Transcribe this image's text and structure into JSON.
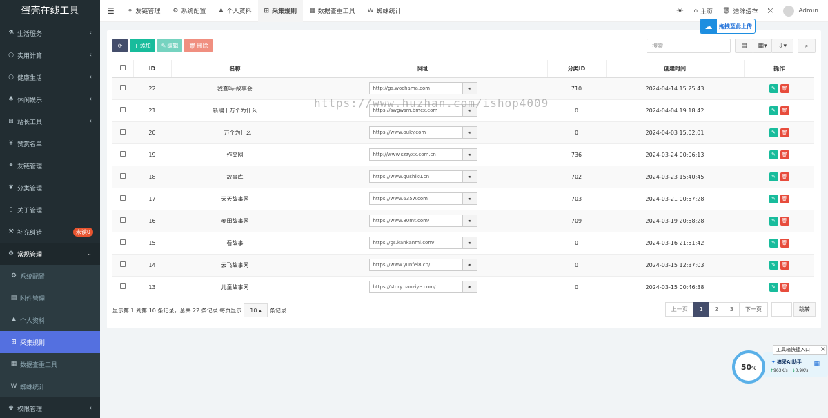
{
  "app": {
    "title": "蛋壳在线工具"
  },
  "sidebar": {
    "items": [
      {
        "label": "生活服务",
        "icon": "flask-icon",
        "glyph": "⚗",
        "arrow": true
      },
      {
        "label": "实用计算",
        "icon": "circle-icon",
        "glyph": "○",
        "arrow": true
      },
      {
        "label": "健康生活",
        "icon": "circle-icon",
        "glyph": "○",
        "arrow": true
      },
      {
        "label": "休闲娱乐",
        "icon": "gamepad-icon",
        "glyph": "♣",
        "arrow": true
      },
      {
        "label": "站长工具",
        "icon": "sitemap-icon",
        "glyph": "⊞",
        "arrow": true
      },
      {
        "label": "赞赏名单",
        "icon": "yen-icon",
        "glyph": "¥",
        "arrow": false
      },
      {
        "label": "友链管理",
        "icon": "link-icon",
        "glyph": "⚭",
        "arrow": false
      },
      {
        "label": "分类管理",
        "icon": "leaf-icon",
        "glyph": "❦",
        "arrow": false
      },
      {
        "label": "关于管理",
        "icon": "file-icon",
        "glyph": "▯",
        "arrow": false
      },
      {
        "label": "补充纠错",
        "icon": "wrench-icon",
        "glyph": "⚒",
        "arrow": false,
        "badge": "未读0"
      },
      {
        "label": "常规管理",
        "icon": "cogs-icon",
        "glyph": "⚙",
        "arrow": true,
        "open": true
      },
      {
        "label": "系统配置",
        "icon": "gear-icon",
        "glyph": "⚙",
        "sub": true
      },
      {
        "label": "附件管理",
        "icon": "file-image-icon",
        "glyph": "▤",
        "sub": true
      },
      {
        "label": "个人资料",
        "icon": "user-icon",
        "glyph": "♟",
        "sub": true
      },
      {
        "label": "采集规则",
        "icon": "sitemap-icon",
        "glyph": "⊞",
        "sub": true,
        "active": true
      },
      {
        "label": "数据查重工具",
        "icon": "table-icon",
        "glyph": "▦",
        "sub": true
      },
      {
        "label": "蜘蛛统计",
        "icon": "weixin-icon",
        "glyph": "W",
        "sub": true
      },
      {
        "label": "权限管理",
        "icon": "group-icon",
        "glyph": "♚",
        "arrow": true
      }
    ]
  },
  "topnav": {
    "tabs": [
      {
        "label": "友链管理",
        "icon": "link-icon",
        "glyph": "⚭"
      },
      {
        "label": "系统配置",
        "icon": "gear-icon",
        "glyph": "⚙"
      },
      {
        "label": "个人资料",
        "icon": "user-icon",
        "glyph": "♟"
      },
      {
        "label": "采集规则",
        "icon": "sitemap-icon",
        "glyph": "⊞",
        "active": true
      },
      {
        "label": "数据查重工具",
        "icon": "table-icon",
        "glyph": "▦"
      },
      {
        "label": "蜘蛛统计",
        "icon": "weixin-icon",
        "glyph": "W"
      }
    ],
    "right": {
      "home": "主页",
      "clear_cache": "清除缓存",
      "user": "Admin"
    }
  },
  "upload_badge": "拖拽至此上传",
  "toolbar": {
    "add": "添加",
    "edit": "编辑",
    "delete": "删除",
    "search_placeholder": "搜索"
  },
  "table": {
    "columns": [
      "ID",
      "名称",
      "网址",
      "分类ID",
      "创建时间",
      "操作"
    ],
    "rows": [
      {
        "id": "22",
        "name": "我查吗-故事会",
        "url": "http://gs.wochama.com",
        "cat": "710",
        "time": "2024-04-14 15:25:43"
      },
      {
        "id": "21",
        "name": "新编十万个为什么",
        "url": "https://swgwsm.bmcx.com",
        "cat": "0",
        "time": "2024-04-04 19:18:42"
      },
      {
        "id": "20",
        "name": "十万个为什么",
        "url": "https://www.ouky.com",
        "cat": "0",
        "time": "2024-04-03 15:02:01"
      },
      {
        "id": "19",
        "name": "作文网",
        "url": "http://www.szzyxx.com.cn",
        "cat": "736",
        "time": "2024-03-24 00:06:13"
      },
      {
        "id": "18",
        "name": "故事库",
        "url": "https://www.gushiku.cn",
        "cat": "702",
        "time": "2024-03-23 15:40:45"
      },
      {
        "id": "17",
        "name": "天天故事网",
        "url": "https://www.635w.com",
        "cat": "703",
        "time": "2024-03-21 00:57:28"
      },
      {
        "id": "16",
        "name": "麦田故事网",
        "url": "https://www.80mt.com/",
        "cat": "709",
        "time": "2024-03-19 20:58:28"
      },
      {
        "id": "15",
        "name": "看故事",
        "url": "https://gs.kankanmi.com/",
        "cat": "0",
        "time": "2024-03-16 21:51:42"
      },
      {
        "id": "14",
        "name": "云飞故事网",
        "url": "https://www.yunfei8.cn/",
        "cat": "0",
        "time": "2024-03-15 12:37:03"
      },
      {
        "id": "13",
        "name": "儿童故事网",
        "url": "https://story.panziye.com/",
        "cat": "0",
        "time": "2024-03-15 00:46:38"
      }
    ]
  },
  "footer": {
    "info_prefix": "显示第 1 到第 10 条记录，总共 22 条记录 每页显示",
    "page_size": "10",
    "info_suffix": "条记录"
  },
  "pager": {
    "prev": "上一页",
    "pages": [
      "1",
      "2",
      "3"
    ],
    "next": "下一页",
    "jump": "跳转"
  },
  "watermark": "https://www.huzhan.com/ishop4009",
  "widget": {
    "percent": "50",
    "percent_sign": "%",
    "title": "工具箱快捷入口",
    "name": "搞采AI助手",
    "up": "963K/s",
    "down": "0.9K/s"
  }
}
